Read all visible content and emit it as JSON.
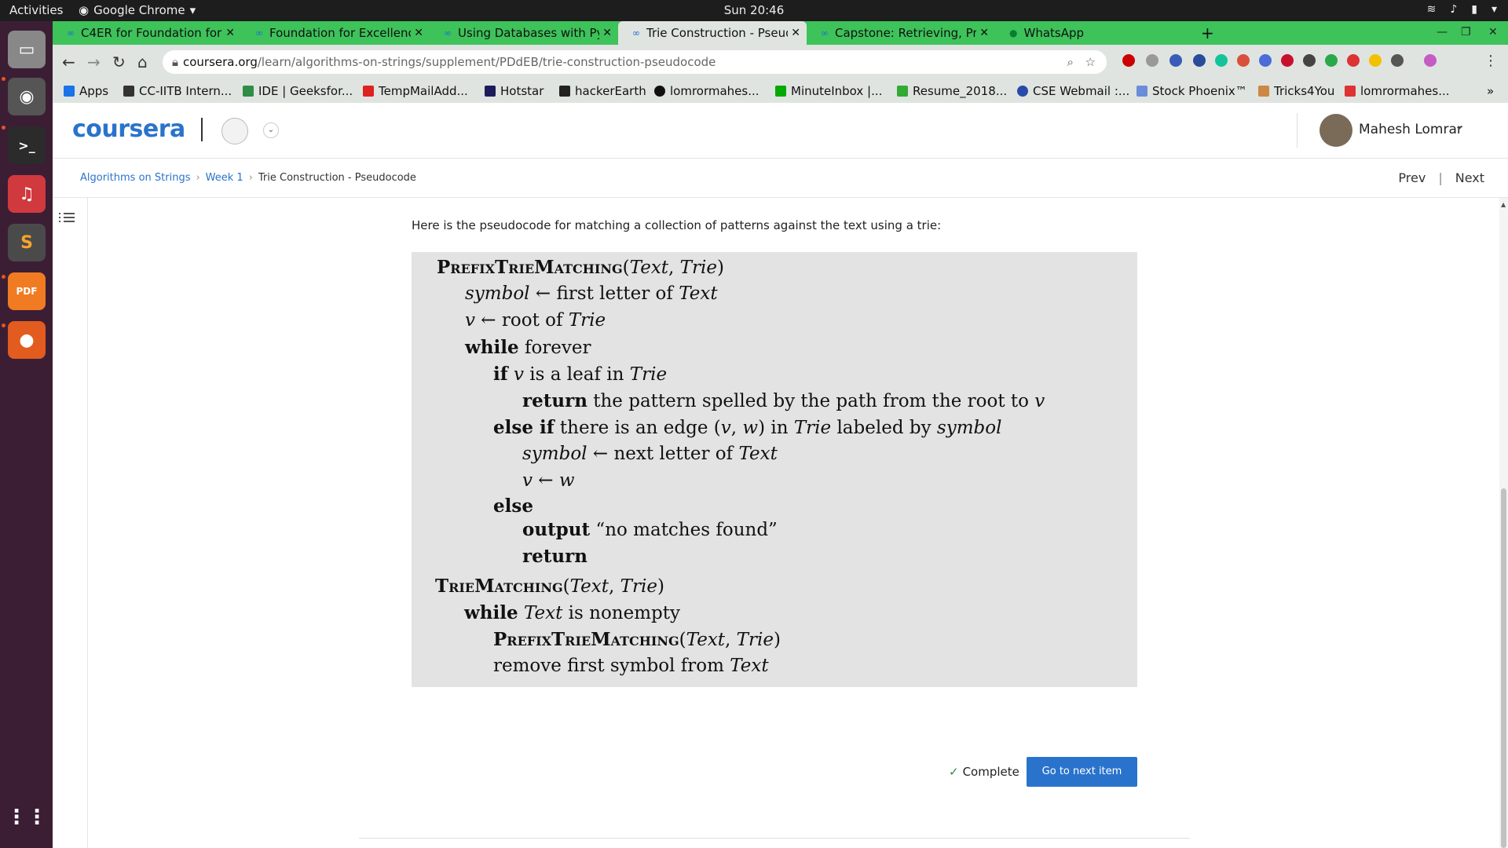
{
  "system": {
    "activities": "Activities",
    "app_name": "Google Chrome",
    "clock": "Sun 20:46"
  },
  "browser": {
    "tabs": [
      {
        "title": "C4ER for Foundation for E"
      },
      {
        "title": "Foundation for Excellenc"
      },
      {
        "title": "Using Databases with Pyt"
      },
      {
        "title": "Trie Construction - Pseudo"
      },
      {
        "title": "Capstone: Retrieving, Pro"
      },
      {
        "title": "WhatsApp"
      }
    ],
    "url_host": "coursera.org",
    "url_path": "/learn/algorithms-on-strings/supplement/PDdEB/trie-construction-pseudocode",
    "bookmarks": [
      "Apps",
      "CC-IITB Intern...",
      "IDE | Geeksfor...",
      "TempMailAdd...",
      "Hotstar",
      "hackerEarth",
      "lomrormahes...",
      "MinuteInbox |...",
      "Resume_2018...",
      "CSE Webmail :...",
      "Stock Phoenix™",
      "Tricks4You",
      "lomrormahes..."
    ]
  },
  "header": {
    "logo": "coursera",
    "user_name": "Mahesh Lomrar"
  },
  "breadcrumb": {
    "course": "Algorithms on Strings",
    "week": "Week 1",
    "current": "Trie Construction - Pseudocode"
  },
  "nav": {
    "prev": "Prev",
    "next": "Next"
  },
  "content": {
    "intro": "Here is the pseudocode for matching a collection of patterns against the text using a trie:"
  },
  "footer": {
    "complete": "Complete",
    "next_button": "Go to next item"
  },
  "colors": {
    "brand": "#2a73cc",
    "tabbar": "#3ec25a",
    "dock": "#3b1e34"
  }
}
